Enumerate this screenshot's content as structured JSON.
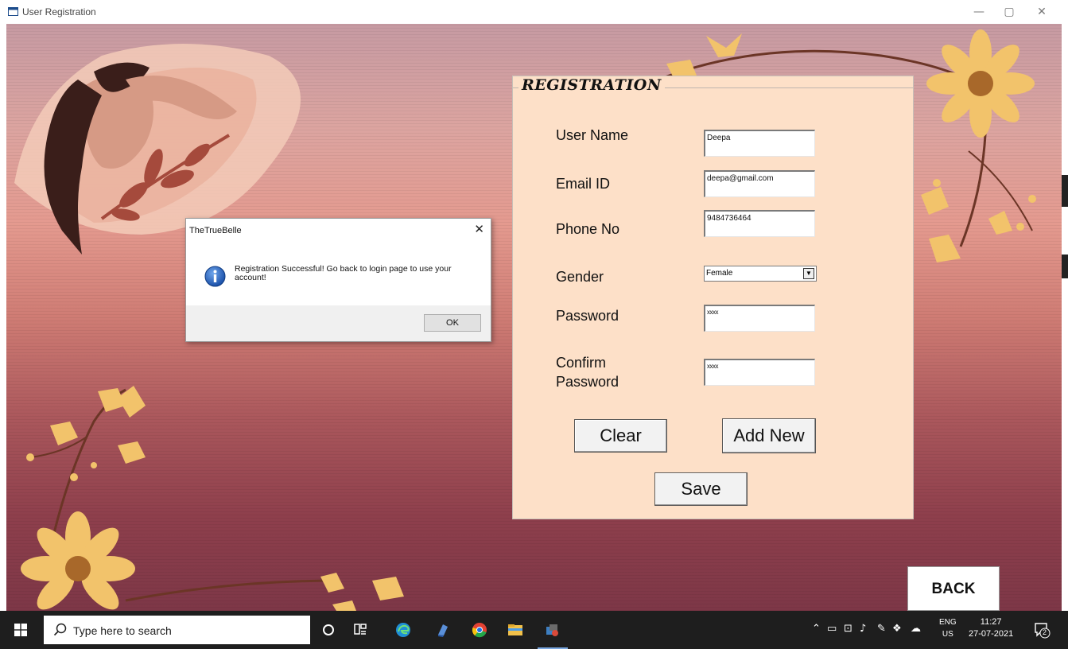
{
  "window": {
    "title": "User Registration",
    "controls": {
      "minimize": "—",
      "maximize": "▢",
      "close": "✕"
    }
  },
  "registration": {
    "title": "REGISTRATION",
    "fields": [
      {
        "label": "User Name",
        "value": "Deepa"
      },
      {
        "label": "Email ID",
        "value": "deepa@gmail.com"
      },
      {
        "label": "Phone No",
        "value": "9484736464"
      },
      {
        "label": "Gender",
        "value": "Female"
      },
      {
        "label": "Password",
        "value": "xxxx"
      },
      {
        "label": "Confirm Password",
        "value": "xxxx"
      }
    ],
    "buttons": {
      "clear": "Clear",
      "add_new": "Add New",
      "save": "Save"
    }
  },
  "back_button": "BACK",
  "dialog": {
    "title": "TheTrueBelle",
    "message": "Registration Successful! Go back to login page to use your account!",
    "ok": "OK",
    "close": "✕"
  },
  "taskbar": {
    "search_placeholder": "Type here to search",
    "language": {
      "line1": "ENG",
      "line2": "US"
    },
    "time": "11:27",
    "date": "27-07-2021",
    "notification_count": "2"
  },
  "colors": {
    "panel_bg": "#fde0c8",
    "taskbar_bg": "#1e1e1e",
    "flower": "#f2c36b",
    "flower_center": "#a8682a",
    "leaf": "#a54a3c"
  }
}
